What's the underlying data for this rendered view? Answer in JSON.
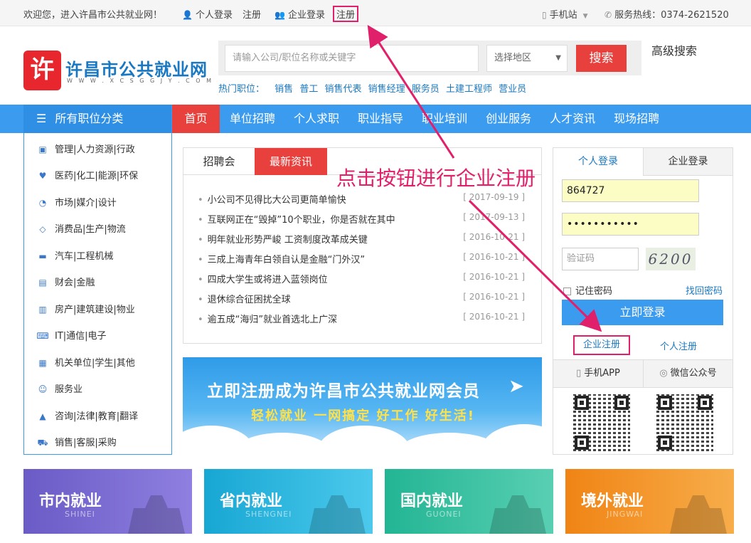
{
  "topbar": {
    "welcome": "欢迎您，进入许昌市公共就业网！",
    "personal_login": "个人登录",
    "personal_register": "注册",
    "enterprise_login": "企业登录",
    "enterprise_register": "注册",
    "mobile_site": "手机站",
    "hotline": "服务热线：0374-2621520"
  },
  "header": {
    "logo_char": "许",
    "site_name": "许昌市公共就业网",
    "site_url": "W W W . X C S G G J Y . C O M"
  },
  "search": {
    "placeholder": "请输入公司/职位名称或关键字",
    "region": "选择地区",
    "button": "搜索",
    "advanced": "高级搜索",
    "hot_label": "热门职位：",
    "hot_jobs": [
      "销售",
      "普工",
      "销售代表",
      "销售经理",
      "服务员",
      "土建工程师",
      "营业员"
    ]
  },
  "nav": {
    "categories_label": "所有职位分类",
    "home": "首页",
    "items": [
      "单位招聘",
      "个人求职",
      "职业指导",
      "职业培训",
      "创业服务",
      "人才资讯",
      "现场招聘"
    ]
  },
  "categories": [
    {
      "icon": "briefcase-icon",
      "label": "管理|人力资源|行政"
    },
    {
      "icon": "heartbeat-icon",
      "label": "医药|化工|能源|环保"
    },
    {
      "icon": "pie-chart-icon",
      "label": "市场|媒介|设计"
    },
    {
      "icon": "diamond-icon",
      "label": "消费品|生产|物流"
    },
    {
      "icon": "car-icon",
      "label": "汽车|工程机械"
    },
    {
      "icon": "money-icon",
      "label": "财会|金融"
    },
    {
      "icon": "building-icon",
      "label": "房产|建筑建设|物业"
    },
    {
      "icon": "keyboard-icon",
      "label": "IT|通信|电子"
    },
    {
      "icon": "institution-icon",
      "label": "机关单位|学生|其他"
    },
    {
      "icon": "smile-icon",
      "label": "服务业"
    },
    {
      "icon": "graduation-cap-icon",
      "label": "咨询|法律|教育|翻译"
    },
    {
      "icon": "cart-icon",
      "label": "销售|客服|采购"
    }
  ],
  "news": {
    "tab_jobfair": "招聘会",
    "tab_latest": "最新资讯",
    "items": [
      {
        "title": "小公司不见得比大公司更简单愉快",
        "date": "[ 2017-09-19 ]"
      },
      {
        "title": "互联网正在“毁掉”10个职业，你是否就在其中",
        "date": "[ 2017-09-13 ]"
      },
      {
        "title": "明年就业形势严峻 工资制度改革成关键",
        "date": "[ 2016-10-21 ]"
      },
      {
        "title": "三成上海青年白领自认是金融“门外汉”",
        "date": "[ 2016-10-21 ]"
      },
      {
        "title": "四成大学生或将进入蓝领岗位",
        "date": "[ 2016-10-21 ]"
      },
      {
        "title": "退休综合征困扰全球",
        "date": "[ 2016-10-21 ]"
      },
      {
        "title": "逾五成“海归”就业首选北上广深",
        "date": "[ 2016-10-21 ]"
      }
    ]
  },
  "banner": {
    "title": "立即注册成为许昌市公共就业网会员",
    "subtitle": "轻松就业  一网搞定    好工作  好生活!"
  },
  "login": {
    "tab_personal": "个人登录",
    "tab_enterprise": "企业登录",
    "username": "864727",
    "password": "•••••••••••",
    "captcha_placeholder": "验证码",
    "captcha_image": "6200",
    "remember": "记住密码",
    "forgot": "找回密码",
    "submit": "立即登录",
    "enterprise_register": "企业注册",
    "personal_register": "个人注册",
    "mobile_app": "手机APP",
    "wechat": "微信公众号"
  },
  "regions": [
    {
      "title": "市内就业",
      "pinyin": "SHINEI",
      "color": "#6a5bc6"
    },
    {
      "title": "省内就业",
      "pinyin": "SHENGNEI",
      "color": "#1fb3d8"
    },
    {
      "title": "国内就业",
      "pinyin": "GUONEI",
      "color": "#2db89a"
    },
    {
      "title": "境外就业",
      "pinyin": "JINGWAI",
      "color": "#f08c1e"
    }
  ],
  "annotation": {
    "text": "点击按钮进行企业注册"
  }
}
